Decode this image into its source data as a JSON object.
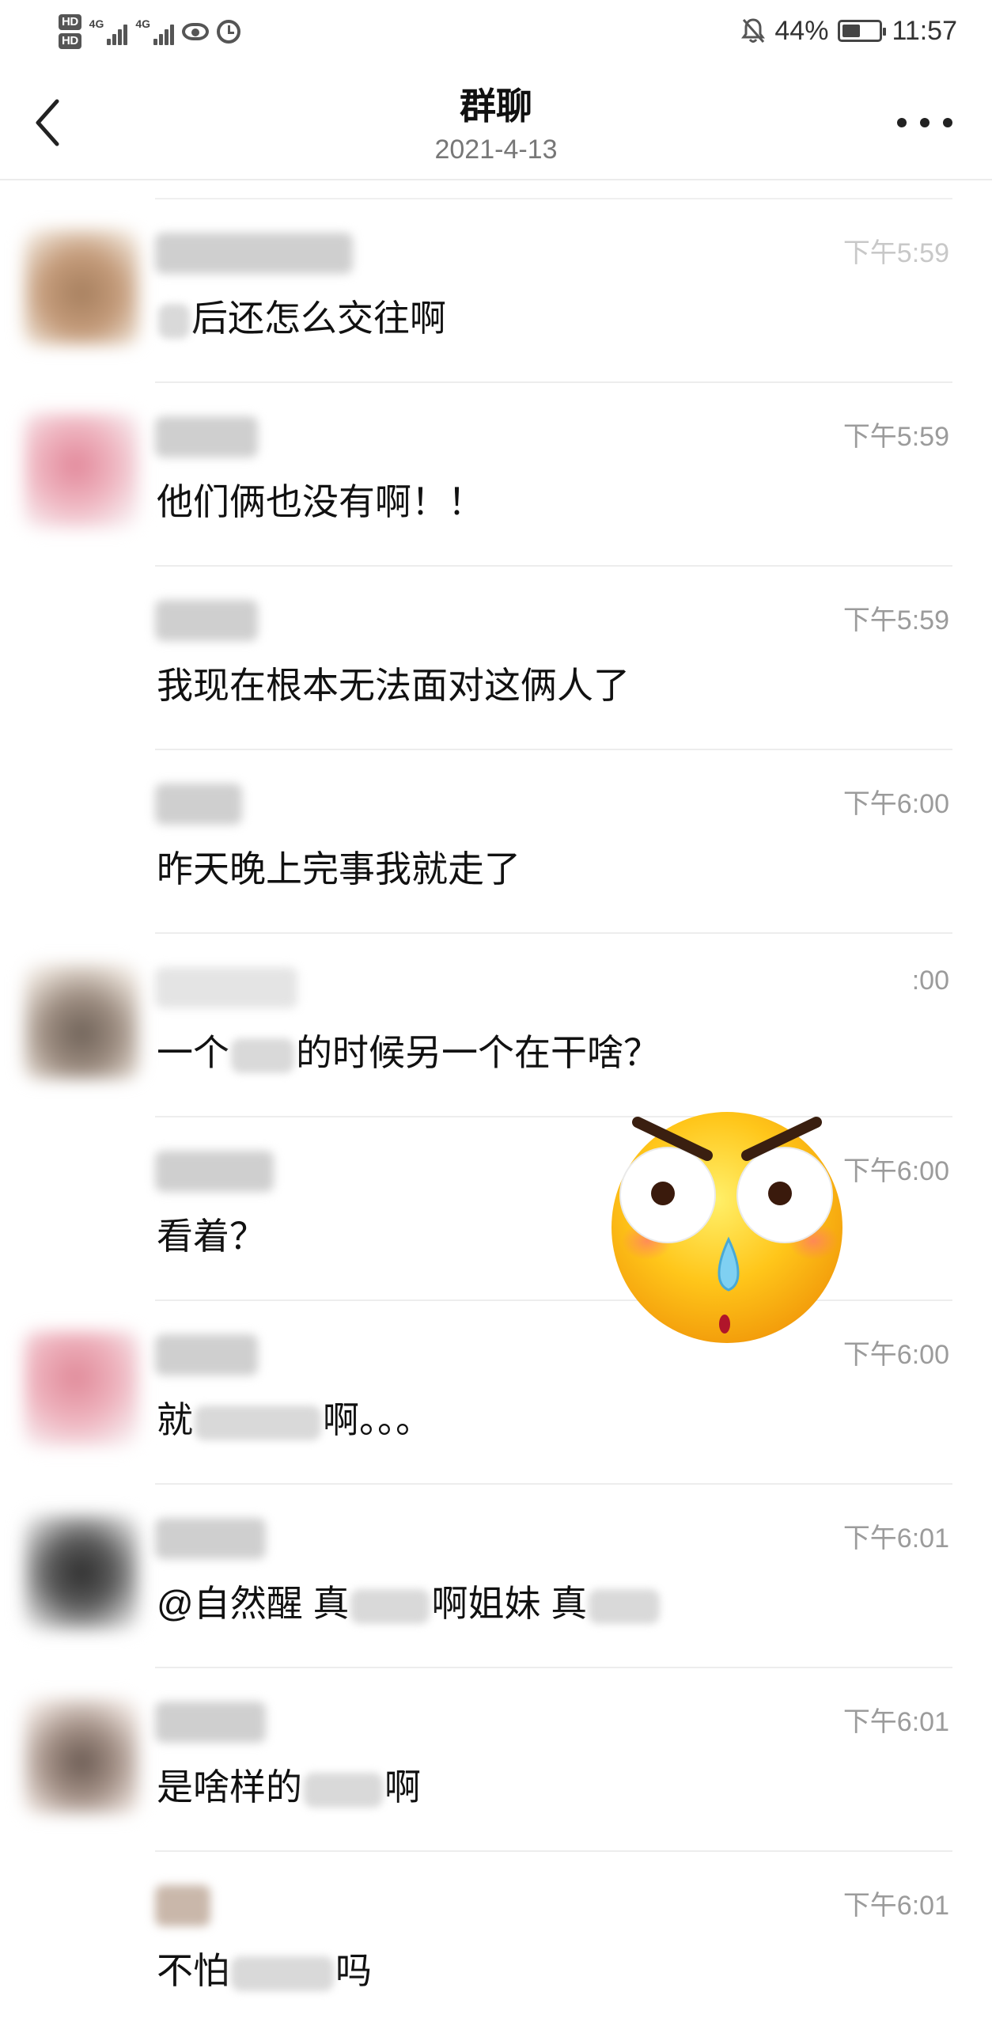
{
  "status_bar": {
    "hd1": "HD",
    "hd2": "HD",
    "net1": "4G",
    "net2": "4G",
    "battery_percent": "44%",
    "time": "11:57",
    "icons": [
      "hd-icon",
      "signal-icon",
      "eye-icon",
      "alarm-icon",
      "mute-bell-icon",
      "battery-icon"
    ]
  },
  "header": {
    "title": "群聊",
    "date": "2021-4-13",
    "back_icon": "chevron-left-icon",
    "more_icon": "more-dots-icon"
  },
  "messages": [
    {
      "time": "下午5:59",
      "pre": "",
      "text": "后还怎么交往啊",
      "post": ""
    },
    {
      "time": "下午5:59",
      "pre": "",
      "text": "他们俩也没有啊！！",
      "post": ""
    },
    {
      "time": "下午5:59",
      "pre": "",
      "text": "我现在根本无法面对这俩人了",
      "post": ""
    },
    {
      "time": "下午6:00",
      "pre": "",
      "text": "昨天晚上完事我就走了",
      "post": ""
    },
    {
      "time": ":00",
      "pre": "一个",
      "text": "的时候另一个在干啥？",
      "post": ""
    },
    {
      "time": "下午6:00",
      "pre": "",
      "text": "看着？",
      "post": ""
    },
    {
      "time": "下午6:00",
      "pre": "就",
      "text": "啊。。。",
      "post": ""
    },
    {
      "time": "下午6:01",
      "pre": "@自然醒 真",
      "text": "啊姐妹 真",
      "post": ""
    },
    {
      "time": "下午6:01",
      "pre": "是啥样的",
      "text": "啊",
      "post": ""
    },
    {
      "time": "下午6:01",
      "pre": "不怕",
      "text": "吗",
      "post": ""
    }
  ],
  "colors": {
    "background": "#ffffff",
    "divider": "#ededed",
    "time_text": "#9b9b9b",
    "emoji_face": "#ffc61a"
  },
  "sticker_icon": "angry-emoji-sticker"
}
